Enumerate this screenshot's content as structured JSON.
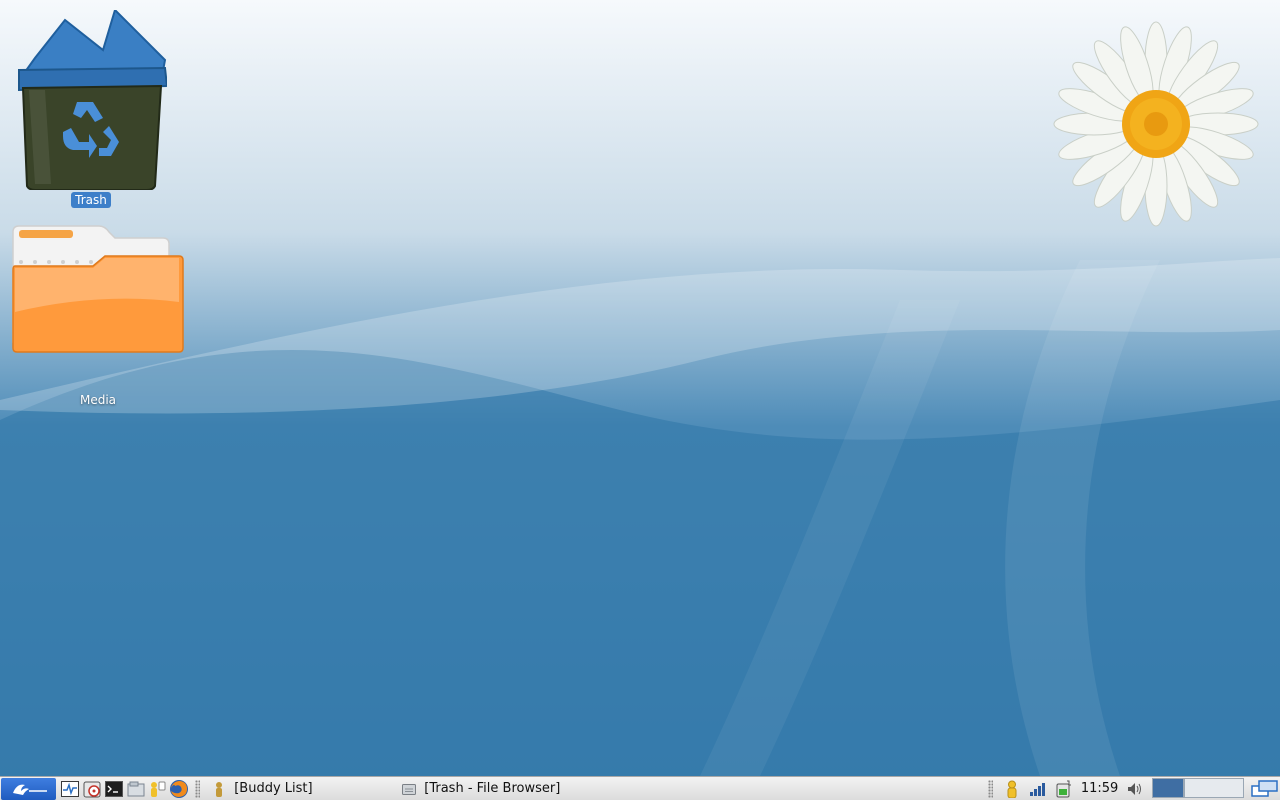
{
  "desktop": {
    "icons": [
      {
        "label": "Trash",
        "selected": true
      },
      {
        "label": "Media",
        "selected": false
      }
    ]
  },
  "panel": {
    "launchers": [
      "main-menu-icon",
      "system-monitor-icon",
      "disc-burner-icon",
      "terminal-icon",
      "file-manager-icon",
      "messenger-icon",
      "firefox-icon"
    ],
    "tasks": [
      {
        "label": "[Buddy List]",
        "icon": "buddy-icon"
      },
      {
        "label": "[Trash - File Browser]",
        "icon": "drive-icon"
      }
    ],
    "tray": [
      "pidgin-status-icon",
      "network-signal-icon",
      "battery-icon",
      "volume-icon"
    ],
    "clock": "11:59",
    "colors": {
      "accent": "#3d7fc9",
      "panel": "#e2e2e2",
      "trash_bin": "#3b4a2a",
      "folder": "#ff9a3c"
    }
  }
}
